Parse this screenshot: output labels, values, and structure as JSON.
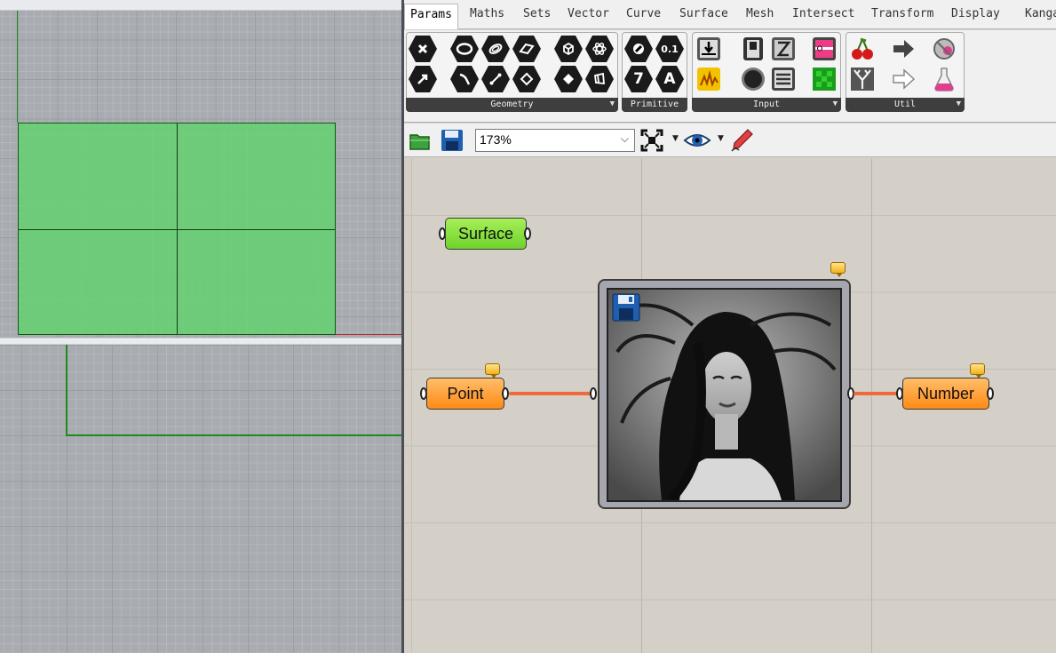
{
  "rhino": {
    "viewports": [
      "top",
      "front"
    ],
    "surface_preview_color": "#60d26e"
  },
  "grasshopper": {
    "tabs": [
      {
        "label": "Params",
        "active": true
      },
      {
        "label": "Maths"
      },
      {
        "label": "Sets"
      },
      {
        "label": "Vector"
      },
      {
        "label": "Curve"
      },
      {
        "label": "Surface"
      },
      {
        "label": "Mesh"
      },
      {
        "label": "Intersect"
      },
      {
        "label": "Transform"
      },
      {
        "label": "Display"
      },
      {
        "label": "Kangaroo"
      }
    ],
    "ribbon_groups": [
      {
        "label": "Geometry"
      },
      {
        "label": "Primitive"
      },
      {
        "label": "Input"
      },
      {
        "label": "Util"
      }
    ],
    "primitive_icon_text": {
      "a": "0.1",
      "b": "7",
      "c": "A"
    },
    "toolbar": {
      "zoom_value": "173%",
      "icons": [
        "open-file-icon",
        "save-file-icon",
        "zoom-extents-icon",
        "preview-eye-icon",
        "sketch-pen-icon"
      ]
    },
    "canvas": {
      "components": {
        "surface": {
          "label": "Surface",
          "color": "#8be04a"
        },
        "point": {
          "label": "Point",
          "color": "#ffa030"
        },
        "number": {
          "label": "Number",
          "color": "#ffa030"
        },
        "image_sampler": {
          "icon": "floppy-disk-icon"
        }
      },
      "wire_color": "#ee6a3a"
    }
  }
}
